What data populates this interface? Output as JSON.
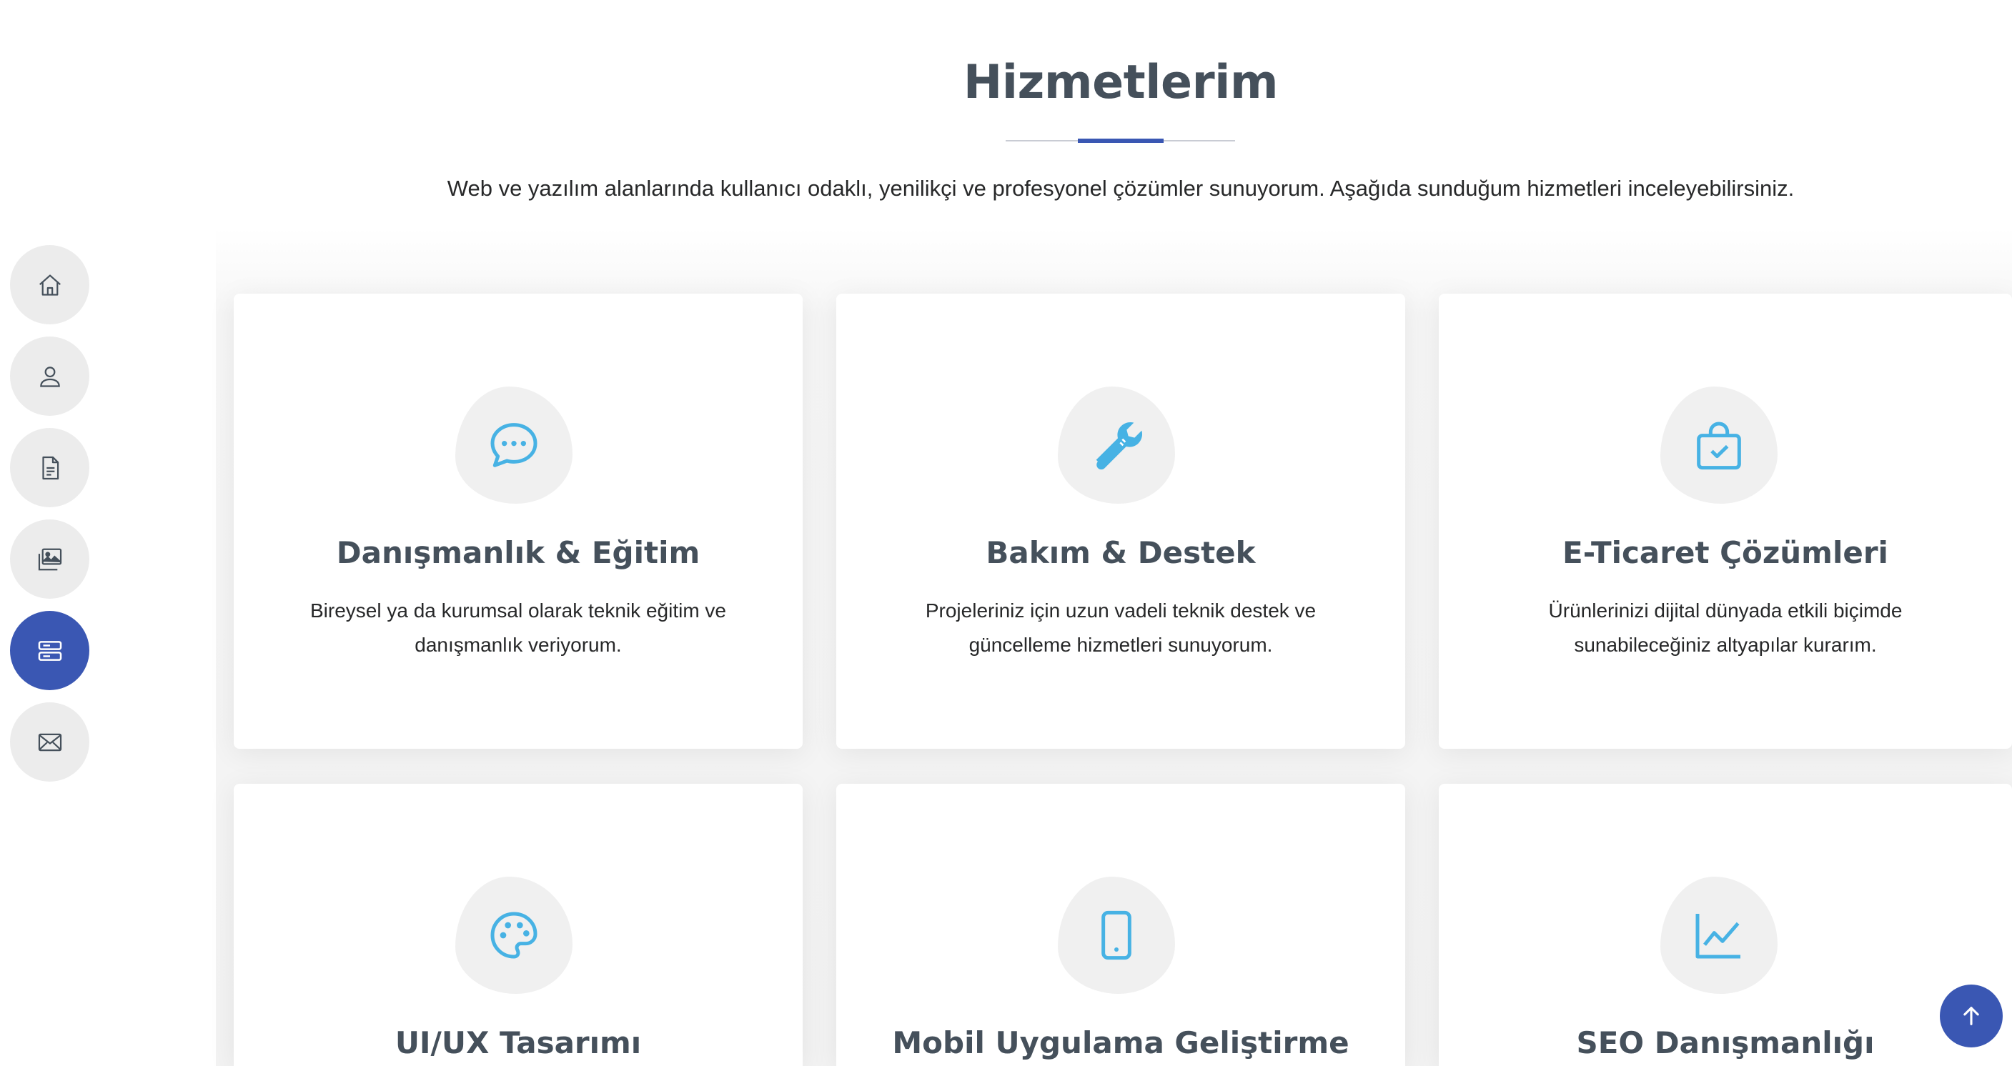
{
  "nav": {
    "items": [
      {
        "name": "home-icon",
        "active": false
      },
      {
        "name": "person-icon",
        "active": false
      },
      {
        "name": "document-icon",
        "active": false
      },
      {
        "name": "images-icon",
        "active": false
      },
      {
        "name": "server-icon",
        "active": true
      },
      {
        "name": "envelope-icon",
        "active": false
      }
    ]
  },
  "section": {
    "title": "Hizmetlerim",
    "description": "Web ve yazılım alanlarında kullanıcı odaklı, yenilikçi ve profesyonel çözümler sunuyorum. Aşağıda sunduğum hizmetleri inceleyebilirsiniz."
  },
  "services": [
    {
      "icon": "chat-dots-icon",
      "title": "Danışmanlık & Eğitim",
      "text": "Bireysel ya da kurumsal olarak teknik eğitim ve danışmanlık veriyorum."
    },
    {
      "icon": "wrench-icon",
      "title": "Bakım & Destek",
      "text": "Projeleriniz için uzun vadeli teknik destek ve güncelleme hizmetleri sunuyorum."
    },
    {
      "icon": "shopping-bag-check-icon",
      "title": "E-Ticaret Çözümleri",
      "text": "Ürünlerinizi dijital dünyada etkili biçimde sunabileceğiniz altyapılar kurarım."
    },
    {
      "icon": "palette-icon",
      "title": "UI/UX Tasarımı",
      "text": ""
    },
    {
      "icon": "phone-icon",
      "title": "Mobil Uygulama Geliştirme",
      "text": ""
    },
    {
      "icon": "graph-up-icon",
      "title": "SEO Danışmanlığı",
      "text": ""
    }
  ],
  "colors": {
    "accent": "#3a57b3",
    "icon": "#47b2e4",
    "heading": "#45505b",
    "nav_bg": "#ececec"
  },
  "back_to_top": {
    "icon": "arrow-up-icon"
  }
}
